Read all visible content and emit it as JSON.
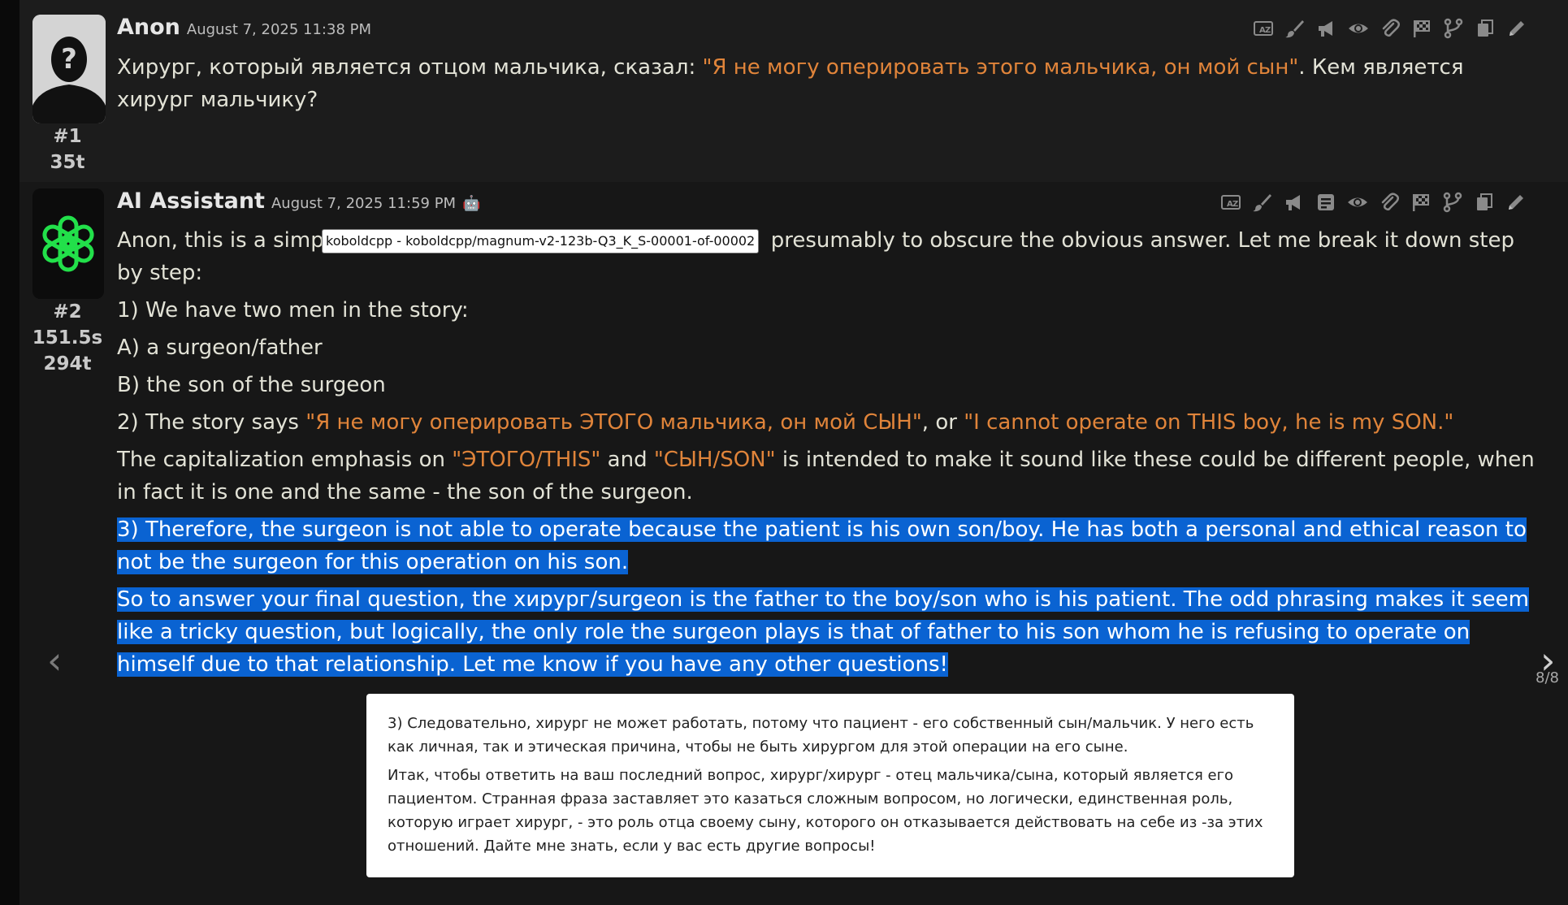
{
  "messages": [
    {
      "author": "Anon",
      "date": "August 7, 2025 11:38 PM",
      "index": "#1",
      "stats": [
        "35t"
      ],
      "text_plain": "Хирург, который является отцом мальчика, сказал: ",
      "text_quote": "\"Я не могу оперировать этого мальчика, он мой сын\"",
      "text_after": ". Кем является хирург мальчику?",
      "avatar": "unknown-person-silhouette"
    },
    {
      "author": "AI Assistant",
      "date": "August 7, 2025 11:59 PM",
      "index": "#2",
      "stats": [
        "151.5s",
        "294t"
      ],
      "avatar": "openai-logo",
      "p1_start": "Anon, this is a simp",
      "p1_end": "presumably to obscure the obvious answer. Let me break it down step by step:",
      "p2": "1) We have two men in the story:",
      "p3": "A) a surgeon/father",
      "p4": "B) the son of the surgeon",
      "p5_a": "2) The story says ",
      "p5_q1": "\"Я не могу оперировать ЭТОГО мальчика, он мой СЫН\"",
      "p5_b": ", or ",
      "p5_q2": "\"I cannot operate on THIS boy, he is my SON.\"",
      "p6_a": "The capitalization emphasis on ",
      "p6_q1": "\"ЭТОГО/THIS\"",
      "p6_b": " and ",
      "p6_q2": "\"СЫН/SON\"",
      "p6_c": " is intended to make it sound like these could be different people, when in fact it is one and the same - the son of the surgeon.",
      "p7": "3) Therefore, the surgeon is not able to operate because the patient is his own son/boy. He has both a personal and ethical reason to not be the surgeon for this operation on his son.",
      "p8": "So to answer your final question, the хирург/surgeon is the father to the boy/son who is his patient. The odd phrasing makes it seem like a tricky question, but logically, the only role the surgeon plays is that of father to his son whom he is refusing to operate on himself due to that relationship. Let me know if you have any other questions!"
    }
  ],
  "tooltip": "koboldcpp - koboldcpp/magnum-v2-123b-Q3_K_S-00001-of-00002",
  "swipe_counter": "8/8",
  "translation_popup": {
    "p1": "3) Следовательно, хирург не может работать, потому что пациент - его собственный сын/мальчик. У него есть как личная, так и этическая причина, чтобы не быть хирургом для этой операции на его сыне.",
    "p2": "Итак, чтобы ответить на ваш последний вопрос, хирург/хирург - отец мальчика/сына, который является его пациентом. Странная фраза заставляет это казаться сложным вопросом, но логически, единственная роль, которую играет хирург, - это роль отца своему сыну, которого он отказывается действовать на себе из -за этих отношений. Дайте мне знать, если у вас есть другие вопросы!"
  },
  "toolbar_icons_msg1": [
    "translate-icon",
    "brush-icon",
    "megaphone-icon",
    "eye-icon",
    "paperclip-icon",
    "flag-icon",
    "branch-icon",
    "copy-icon",
    "pencil-icon"
  ],
  "toolbar_icons_msg2": [
    "translate-icon",
    "brush-icon",
    "megaphone-icon",
    "notes-icon",
    "eye-icon",
    "paperclip-icon",
    "flag-icon",
    "branch-icon",
    "copy-icon",
    "pencil-icon"
  ],
  "colors": {
    "background": "#171717",
    "quote": "#e0843a",
    "selection": "#0a63d2",
    "logo_green": "#22e04a"
  }
}
